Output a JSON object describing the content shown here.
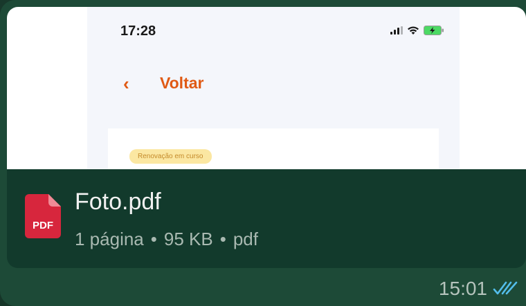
{
  "preview": {
    "status_time": "17:28",
    "back_label": "Voltar",
    "badge": "Renovação em curso"
  },
  "file": {
    "icon_label": "PDF",
    "name": "Foto.pdf",
    "pages": "1 página",
    "size": "95 KB",
    "type": "pdf",
    "separator": "•"
  },
  "message": {
    "time": "15:01",
    "status_icon": "double-check-icon"
  },
  "colors": {
    "accent_orange": "#e05a14",
    "pdf_red": "#d7263d",
    "read_ticks": "#53bdeb",
    "bubble_bg": "#123a2c"
  }
}
